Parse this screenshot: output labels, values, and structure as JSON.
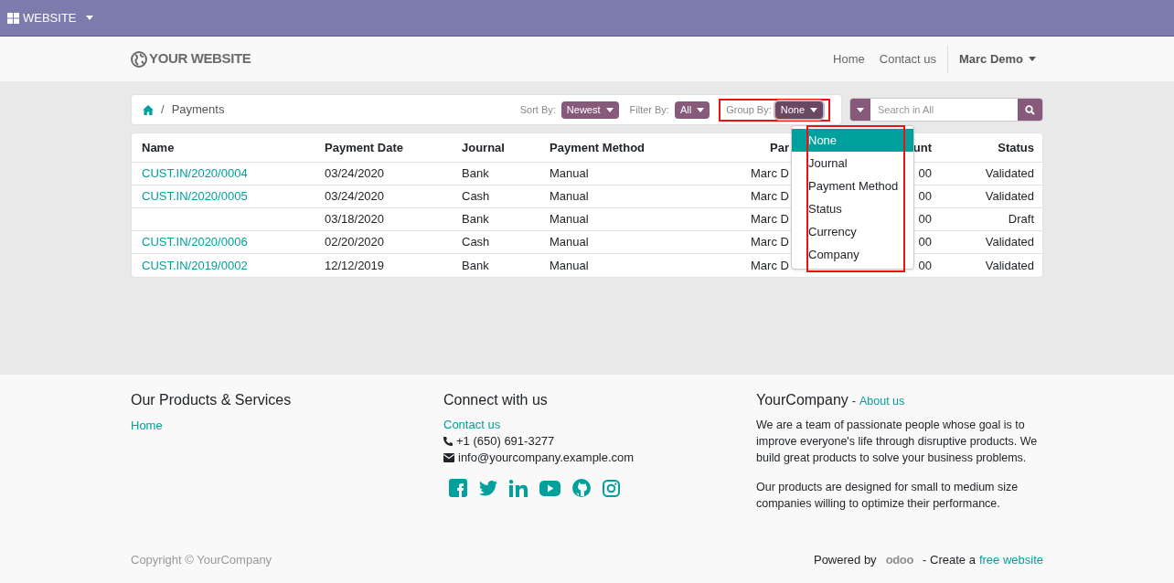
{
  "admin_bar": {
    "app_menu": "WEBSITE"
  },
  "navbar": {
    "logo": "YOUR WEBSITE",
    "links": [
      {
        "label": "Home"
      },
      {
        "label": "Contact us"
      }
    ],
    "user": "Marc Demo"
  },
  "breadcrumb": {
    "separator": "/",
    "current": "Payments"
  },
  "toolbar": {
    "sort_label": "Sort By:",
    "sort_value": "Newest",
    "filter_label": "Filter By:",
    "filter_value": "All",
    "group_label": "Group By:",
    "group_value": "None",
    "search_placeholder": "Search in All"
  },
  "group_menu": {
    "items": [
      {
        "label": "None",
        "selected": true
      },
      {
        "label": "Journal",
        "selected": false
      },
      {
        "label": "Payment Method",
        "selected": false
      },
      {
        "label": "Status",
        "selected": false
      },
      {
        "label": "Currency",
        "selected": false
      },
      {
        "label": "Company",
        "selected": false
      }
    ]
  },
  "table": {
    "columns": [
      "Name",
      "Payment Date",
      "Journal",
      "Payment Method",
      "Par",
      "unt",
      "Status"
    ],
    "rows": [
      [
        "CUST.IN/2020/0004",
        "03/24/2020",
        "Bank",
        "Manual",
        "Marc D",
        "00",
        "Validated"
      ],
      [
        "CUST.IN/2020/0005",
        "03/24/2020",
        "Cash",
        "Manual",
        "Marc D",
        "00",
        "Validated"
      ],
      [
        null,
        "03/18/2020",
        "Bank",
        "Manual",
        "Marc D",
        "00",
        "Draft"
      ],
      [
        "CUST.IN/2020/0006",
        "02/20/2020",
        "Cash",
        "Manual",
        "Marc D",
        "00",
        "Validated"
      ],
      [
        "CUST.IN/2019/0002",
        "12/12/2019",
        "Bank",
        "Manual",
        "Marc D",
        "00",
        "Validated"
      ]
    ]
  },
  "footer": {
    "products": {
      "title": "Our Products & Services",
      "links": [
        "Home"
      ]
    },
    "connect": {
      "title": "Connect with us",
      "link": "Contact us",
      "phone": "+1 (650) 691-3277",
      "email": "info@yourcompany.example.com"
    },
    "about": {
      "title": "YourCompany",
      "separator": "-",
      "link": "About us",
      "paragraphs": [
        "We are a team of passionate people whose goal is to improve everyone's life through disruptive products. We build great products to solve your business problems.",
        "Our products are designed for small to medium size companies willing to optimize their performance."
      ]
    },
    "copyright": "Copyright © YourCompany",
    "powered_by": "Powered by",
    "brand": "odoo",
    "create_text": "- Create a",
    "create_link": "free website"
  }
}
